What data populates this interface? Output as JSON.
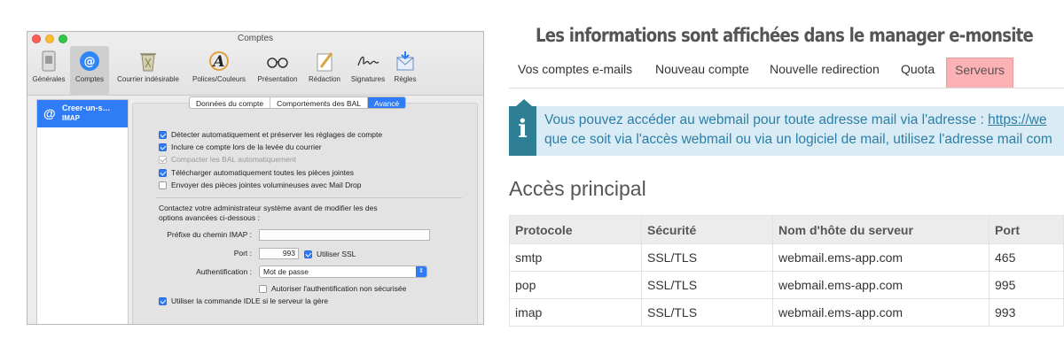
{
  "mail_prefs": {
    "window_title": "Comptes",
    "toolbar": [
      {
        "label": "Générales",
        "icon": "switch-icon"
      },
      {
        "label": "Comptes",
        "icon": "at-icon",
        "active": true
      },
      {
        "label": "Courrier indésirable",
        "icon": "trash-icon"
      },
      {
        "label": "Polices/Couleurs",
        "icon": "font-icon"
      },
      {
        "label": "Présentation",
        "icon": "glasses-icon"
      },
      {
        "label": "Rédaction",
        "icon": "pen-icon"
      },
      {
        "label": "Signatures",
        "icon": "signature-icon"
      },
      {
        "label": "Règles",
        "icon": "rules-icon"
      }
    ],
    "account": {
      "icon": "@",
      "name": "Creer-un-s…",
      "type": "IMAP"
    },
    "tabs": [
      "Données du compte",
      "Comportements des BAL",
      "Avancé"
    ],
    "active_tab": "Avancé",
    "checkboxes": [
      {
        "label": "Détecter automatiquement et préserver les réglages de compte",
        "checked": true,
        "disabled": false
      },
      {
        "label": "Inclure ce compte lors de la levée du courrier",
        "checked": true,
        "disabled": false
      },
      {
        "label": "Compacter les BAL automatiquement",
        "checked": true,
        "disabled": true
      },
      {
        "label": "Télécharger automatiquement toutes les pièces jointes",
        "checked": true,
        "disabled": false
      },
      {
        "label": "Envoyer des pièces jointes volumineuses avec Mail Drop",
        "checked": false,
        "disabled": false
      }
    ],
    "admin_note_line1": "Contactez votre administrateur système avant de modifier les des",
    "admin_note_line2": "options avancées ci-dessous :",
    "prefix_label": "Préfixe du chemin IMAP :",
    "prefix_value": "",
    "port_label": "Port :",
    "port_value": "993",
    "ssl_label": "Utiliser SSL",
    "ssl_checked": true,
    "auth_label": "Authentification :",
    "auth_value": "Mot de passe",
    "insecure_label": "Autoriser l'authentification non sécurisée",
    "insecure_checked": false,
    "idle_label": "Utiliser la commande IDLE si le serveur la gère",
    "idle_checked": true
  },
  "webpage": {
    "heading": "Les informations sont affichées dans le manager e-monsite",
    "tabs": [
      "Vos comptes e-mails",
      "Nouveau compte",
      "Nouvelle redirection",
      "Quota",
      "Serveurs"
    ],
    "active_tab": "Serveurs",
    "info_icon": "i",
    "info_line1_text": "Vous pouvez accéder au webmail pour toute adresse mail via l'adresse : ",
    "info_line1_link": "https://we",
    "info_line2": "que ce soit via l'accès webmail ou via un logiciel de mail, utilisez l'adresse mail com",
    "section_title": "Accès principal",
    "table": {
      "columns": [
        "Protocole",
        "Sécurité",
        "Nom d'hôte du serveur",
        "Port"
      ],
      "rows": [
        [
          "smtp",
          "SSL/TLS",
          "webmail.ems-app.com",
          "465"
        ],
        [
          "pop",
          "SSL/TLS",
          "webmail.ems-app.com",
          "995"
        ],
        [
          "imap",
          "SSL/TLS",
          "webmail.ems-app.com",
          "993"
        ]
      ]
    }
  },
  "colors": {
    "mac_accent": "#2f7cf6",
    "info_bg": "#d9ecf5",
    "info_icon_bg": "#2e7e96",
    "info_text": "#2c7ea7",
    "active_tab_bg": "#fcb2b4"
  }
}
